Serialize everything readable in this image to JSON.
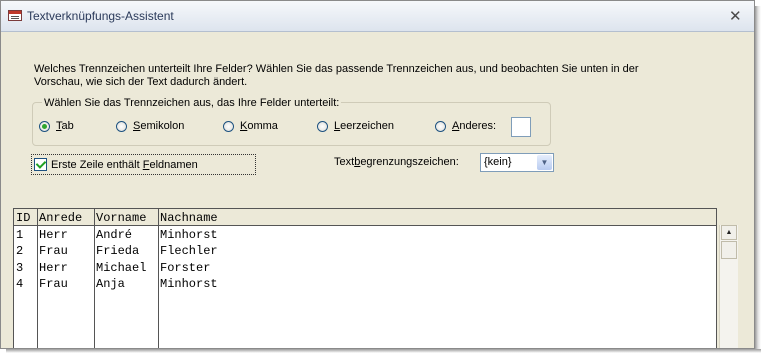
{
  "window": {
    "title": "Textverknüpfungs-Assistent",
    "close_icon": "close-icon"
  },
  "instruction": "Welches Trennzeichen unterteilt Ihre Felder?  Wählen Sie das passende Trennzeichen aus, und beobachten Sie unten in der Vorschau, wie sich der Text dadurch ändert.",
  "delimiter": {
    "legend": "Wählen Sie das Trennzeichen aus, das Ihre Felder unterteilt:",
    "options": [
      {
        "label": "Tab",
        "mnemonic": "T",
        "rest": "ab",
        "checked": true
      },
      {
        "label": "Semikolon",
        "mnemonic": "S",
        "rest": "emikolon",
        "checked": false
      },
      {
        "label": "Komma",
        "mnemonic": "K",
        "rest": "omma",
        "checked": false
      },
      {
        "label": "Leerzeichen",
        "mnemonic": "L",
        "rest": "eerzeichen",
        "checked": false
      },
      {
        "label": "Anderes:",
        "mnemonic": "A",
        "rest": "nderes:",
        "checked": false
      }
    ],
    "other_value": ""
  },
  "first_row": {
    "pre": "Erste Zeile enthält ",
    "mnemonic": "F",
    "post": "eldnamen",
    "checked": true
  },
  "qualifier": {
    "pre": "Text",
    "mnemonic": "b",
    "post": "egrenzungszeichen:",
    "value": "{kein}"
  },
  "preview": {
    "columns": [
      "ID",
      "Anrede",
      "Vorname",
      "Nachname"
    ],
    "rows": [
      [
        "1",
        "Herr",
        "André",
        "Minhorst"
      ],
      [
        "2",
        "Frau",
        "Frieda",
        "Flechler"
      ],
      [
        "3",
        "Herr",
        "Michael",
        "Forster"
      ],
      [
        "4",
        "Frau",
        "Anja",
        "Minhorst"
      ]
    ]
  }
}
